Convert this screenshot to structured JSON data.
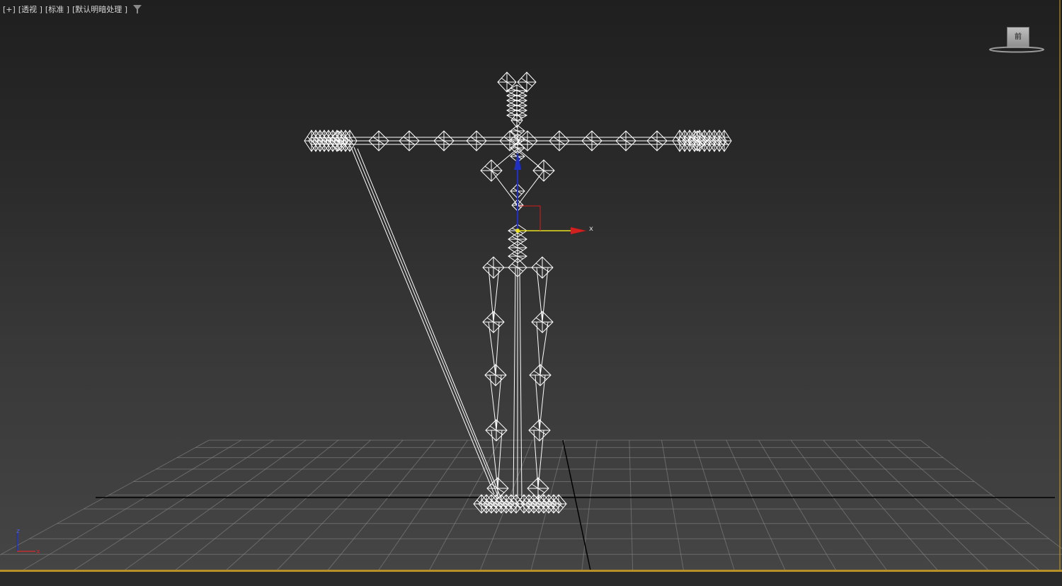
{
  "viewport": {
    "label_plus": "[+]",
    "label_view": "[透视 ]",
    "label_shading": "[标准 ]",
    "label_lighting": "[默认明暗处理 ]"
  },
  "viewcube": {
    "face_text": "前"
  },
  "gizmo": {
    "x_label": "x"
  },
  "tripod": {
    "z_label": "z",
    "x_label": "x"
  },
  "colors": {
    "border": "#b8902a",
    "wire": "#ffffff",
    "grid": "#8a8a8a",
    "axis_x": "#d02020",
    "axis_y": "#e8e020",
    "axis_z": "#2030c0"
  },
  "icons": [
    "filter-icon",
    "viewcube-icon",
    "axis-tripod-icon",
    "transform-gizmo-icon"
  ]
}
